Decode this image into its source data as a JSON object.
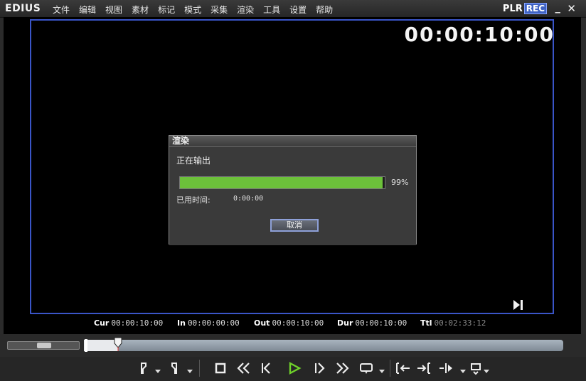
{
  "app": {
    "logo": "EDIUS",
    "menu": [
      "文件",
      "编辑",
      "视图",
      "素材",
      "标记",
      "模式",
      "采集",
      "渲染",
      "工具",
      "设置",
      "帮助"
    ],
    "plr": "PLR",
    "rec": "REC",
    "minimize": "_",
    "close": "✕"
  },
  "preview": {
    "timecode": "00:00:10:00"
  },
  "dialog": {
    "title": "渲染",
    "status": "正在输出",
    "progress": 0.99,
    "progress_text": "99%",
    "elapsed_label": "已用时间:",
    "elapsed_value": "0:00:00",
    "cancel_label": "取消"
  },
  "infobar": {
    "cur_label": "Cur",
    "cur_value": "00:00:10:00",
    "in_label": "In",
    "in_value": "00:00:00:00",
    "out_label": "Out",
    "out_value": "00:00:10:00",
    "dur_label": "Dur",
    "dur_value": "00:00:10:00",
    "ttl_label": "Ttl",
    "ttl_value": "00:02:33:12"
  },
  "colors": {
    "accent_blue": "#3a55c8",
    "progress_green": "#6cc13a",
    "play_green": "#6fd12a"
  },
  "transport_icons": [
    "set-in-icon",
    "set-out-icon",
    "stop-icon",
    "rewind-icon",
    "step-back-icon",
    "play-icon",
    "step-forward-icon",
    "fast-forward-icon",
    "loop-icon",
    "insert-icon",
    "overwrite-icon",
    "three-point-icon",
    "export-icon"
  ]
}
